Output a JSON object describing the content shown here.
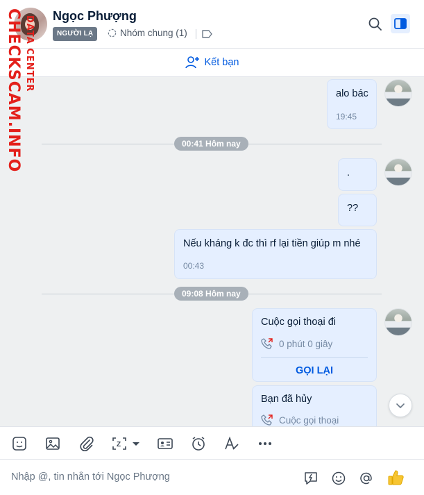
{
  "header": {
    "name": "Ngọc Phượng",
    "badge": "NGƯỜI LẠ",
    "group_link": "Nhóm chung (1)"
  },
  "add_friend": {
    "label": "Kết bạn"
  },
  "messages": [
    {
      "text": "alo bác",
      "time": "19:45"
    },
    {
      "text": "."
    },
    {
      "text": "??"
    },
    {
      "text": "Nếu kháng k đc thì rf lại tiền giúp m nhé",
      "time": "00:43"
    }
  ],
  "dividers": [
    "00:41 Hôm nay",
    "09:08 Hôm nay"
  ],
  "call_card": {
    "title": "Cuộc gọi thoại đi",
    "duration": "0 phút 0 giây",
    "action": "GỌI LẠI"
  },
  "cancel_card": {
    "title": "Bạn đã hủy",
    "sub": "Cuộc gọi thoại"
  },
  "input": {
    "placeholder": "Nhập @, tin nhắn tới Ngọc Phượng"
  },
  "watermark": {
    "main": "CHECKSCAM.INFO",
    "sub": "DATA CENTER"
  },
  "colors": {
    "accent": "#005ae0",
    "bubble": "#e5efff",
    "chat_bg": "#eef0f1",
    "missed_call": "#e3201b"
  }
}
